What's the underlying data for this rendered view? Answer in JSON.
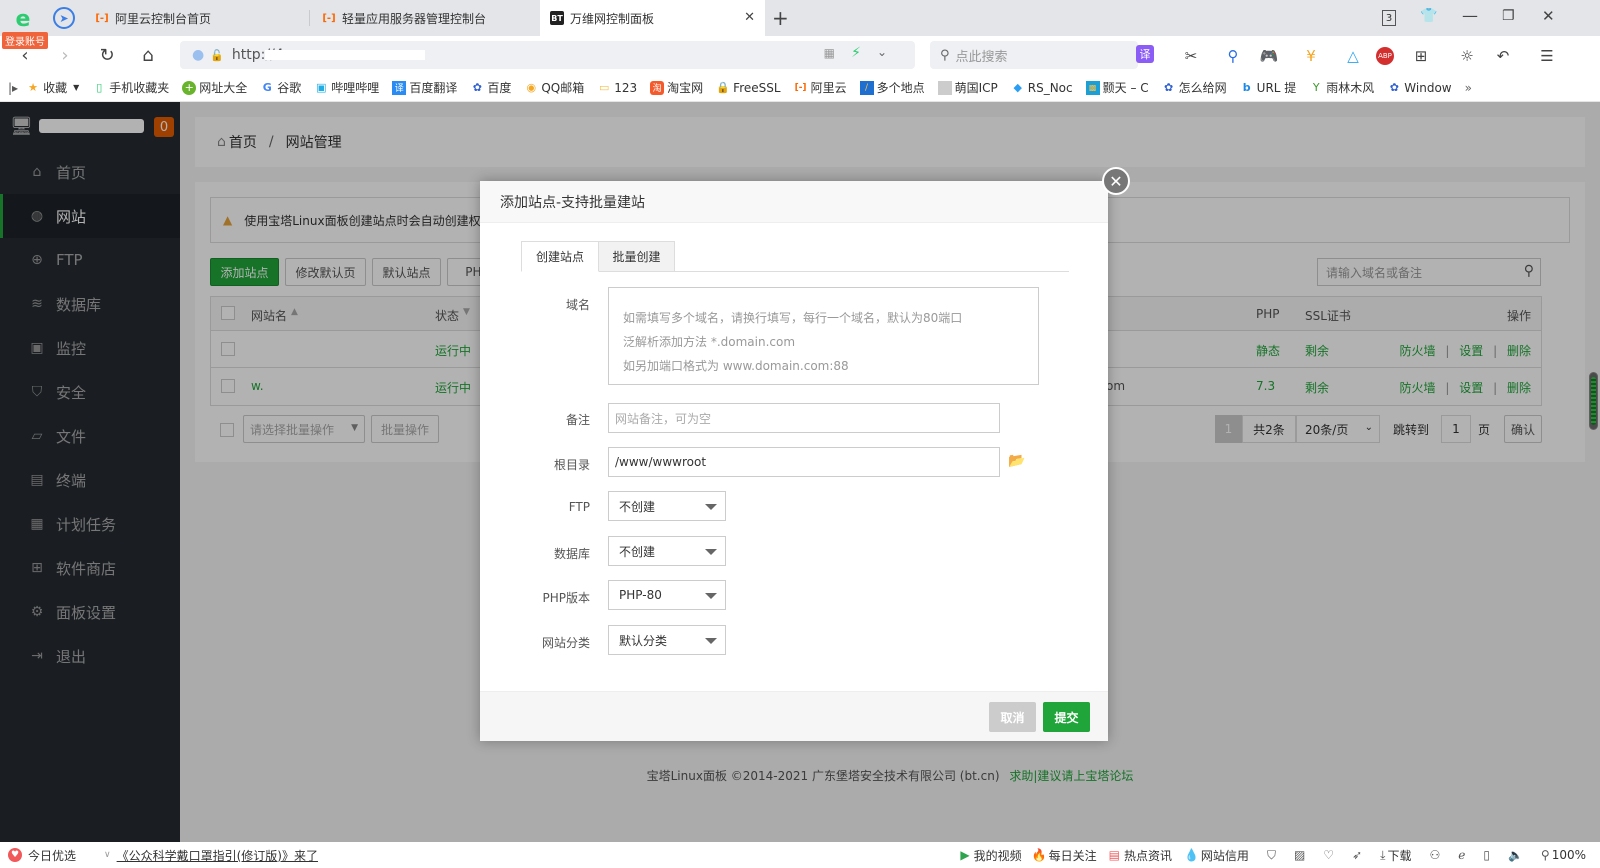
{
  "browser": {
    "login_badge": "登录账号",
    "tabs": [
      {
        "label": "阿里云控制台首页",
        "icon": "aliyun-icon"
      },
      {
        "label": "轻量应用服务器管理控制台",
        "icon": "aliyun-icon"
      },
      {
        "label": "万维网控制面板",
        "icon": "bt-icon",
        "active": true
      }
    ],
    "tab_count": "3",
    "url": "http://4.",
    "search_placeholder": "点此搜索",
    "bookmarks": [
      {
        "label": "收藏",
        "icon": "star-icon"
      },
      {
        "label": "手机收藏夹",
        "icon": "phone-icon"
      },
      {
        "label": "网址大全",
        "icon": "plus-circle-icon"
      },
      {
        "label": "谷歌",
        "icon": "google-icon"
      },
      {
        "label": "哔哩哔哩",
        "icon": "bilibili-icon"
      },
      {
        "label": "百度翻译",
        "icon": "translate-icon"
      },
      {
        "label": "百度",
        "icon": "baidu-icon"
      },
      {
        "label": "QQ邮箱",
        "icon": "qqmail-icon"
      },
      {
        "label": "123",
        "icon": "folder-icon"
      },
      {
        "label": "淘宝网",
        "icon": "taobao-icon"
      },
      {
        "label": "FreeSSL",
        "icon": "lock-icon"
      },
      {
        "label": "阿里云",
        "icon": "aliyun-icon"
      },
      {
        "label": "多个地点",
        "icon": "site-icon"
      },
      {
        "label": "萌国ICP",
        "icon": "avatar-icon"
      },
      {
        "label": "RS_Noc",
        "icon": "rs-icon"
      },
      {
        "label": "颢天 – C",
        "icon": "ht-icon"
      },
      {
        "label": "怎么给网",
        "icon": "baidu-icon"
      },
      {
        "label": "URL 提",
        "icon": "bing-icon"
      },
      {
        "label": "雨林木风",
        "icon": "sprout-icon"
      },
      {
        "label": "Window",
        "icon": "baidu-icon"
      }
    ],
    "more": "»"
  },
  "sidebar": {
    "badge": "0",
    "items": [
      {
        "label": "首页",
        "icon": "home-icon"
      },
      {
        "label": "网站",
        "icon": "globe-icon",
        "active": true
      },
      {
        "label": "FTP",
        "icon": "ftp-icon"
      },
      {
        "label": "数据库",
        "icon": "database-icon"
      },
      {
        "label": "监控",
        "icon": "monitor-icon"
      },
      {
        "label": "安全",
        "icon": "shield-icon"
      },
      {
        "label": "文件",
        "icon": "folder-icon"
      },
      {
        "label": "终端",
        "icon": "terminal-icon"
      },
      {
        "label": "计划任务",
        "icon": "calendar-icon"
      },
      {
        "label": "软件商店",
        "icon": "grid-icon"
      },
      {
        "label": "面板设置",
        "icon": "gear-icon"
      },
      {
        "label": "退出",
        "icon": "logout-icon"
      }
    ]
  },
  "breadcrumb": {
    "home": "首页",
    "sep": "/",
    "current": "网站管理"
  },
  "notice": "使用宝塔Linux面板创建站点时会自动创建权",
  "toolbar": {
    "add_site": "添加站点",
    "edit_default": "修改默认页",
    "default_site": "默认站点",
    "php": "PHP",
    "search_placeholder": "请输入域名或备注"
  },
  "table": {
    "headers": {
      "name": "网站名",
      "status": "状态",
      "php": "PHP",
      "ssl": "SSL证书",
      "actions": "操作"
    },
    "rows": [
      {
        "name": "",
        "status": "运行中",
        "remark": "",
        "php": "静态",
        "ssl": "剩余",
        "actions": [
          "防火墙",
          "设置",
          "删除"
        ]
      },
      {
        "name": "w.",
        "status": "运行中",
        "remark": "om",
        "php": "7.3",
        "ssl": "剩余",
        "actions": [
          "防火墙",
          "设置",
          "删除"
        ]
      }
    ],
    "action_sep": "|",
    "batch_placeholder": "请选择批量操作",
    "batch_button": "批量操作"
  },
  "pagination": {
    "current": "1",
    "total": "共2条",
    "per_page": "20条/页",
    "jump_label": "跳转到",
    "jump_value": "1",
    "page_unit": "页",
    "confirm": "确认"
  },
  "footer": {
    "copyright": "宝塔Linux面板 ©2014-2021 广东堡塔安全技术有限公司 (bt.cn)",
    "help_link": "求助|建议请上宝塔论坛"
  },
  "modal": {
    "title": "添加站点-支持批量建站",
    "tabs": [
      "创建站点",
      "批量创建"
    ],
    "fields": {
      "domain_label": "域名",
      "domain_placeholder_lines": [
        "如需填写多个域名，请换行填写，每行一个域名，默认为80端口",
        "泛解析添加方法 *.domain.com",
        "如另加端口格式为 www.domain.com:88"
      ],
      "remark_label": "备注",
      "remark_placeholder": "网站备注，可为空",
      "root_label": "根目录",
      "root_value": "/www/wwwroot",
      "ftp_label": "FTP",
      "ftp_value": "不创建",
      "db_label": "数据库",
      "db_value": "不创建",
      "php_label": "PHP版本",
      "php_value": "PHP-80",
      "category_label": "网站分类",
      "category_value": "默认分类"
    },
    "cancel": "取消",
    "submit": "提交"
  },
  "statusbar": {
    "left_label": "今日优选",
    "news_link": "《公众科学戴口罩指引(修订版)》来了",
    "items": [
      "我的视频",
      "每日关注",
      "热点资讯",
      "网站信用"
    ],
    "download": "下载",
    "zoom": "100%"
  }
}
